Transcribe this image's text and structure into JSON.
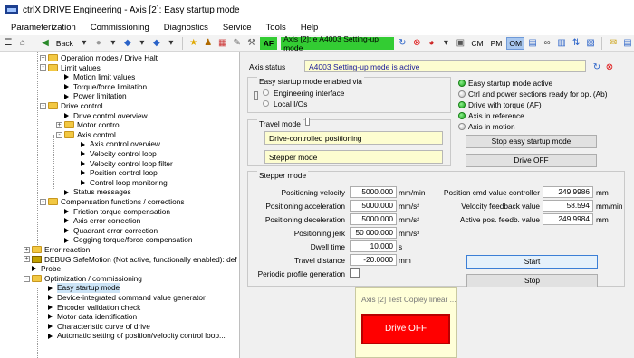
{
  "window": {
    "title": "ctrlX DRIVE Engineering - Axis [2]: Easy startup mode"
  },
  "menu": [
    "Parameterization",
    "Commissioning",
    "Diagnostics",
    "Service",
    "Tools",
    "Help"
  ],
  "toolbar": {
    "back": "Back",
    "af": "AF",
    "axis_status": "Axis [2]: e   A4003 Setting-up mode",
    "cm": "CM",
    "pm": "PM",
    "om": "OM"
  },
  "tree": [
    {
      "label": "Operation modes / Drive Halt",
      "type": "folder",
      "expander": "+",
      "level": 1
    },
    {
      "label": "Limit values",
      "type": "folder",
      "expander": "-",
      "level": 1
    },
    {
      "label": "Motion limit values",
      "type": "item",
      "level": 2
    },
    {
      "label": "Torque/force limitation",
      "type": "item",
      "level": 2
    },
    {
      "label": "Power limitation",
      "type": "item",
      "level": 2
    },
    {
      "label": "Drive control",
      "type": "folder",
      "expander": "-",
      "level": 1
    },
    {
      "label": "Drive control overview",
      "type": "item",
      "level": 2
    },
    {
      "label": "Motor control",
      "type": "folder",
      "expander": "+",
      "level": 2
    },
    {
      "label": "Axis control",
      "type": "folder",
      "expander": "-",
      "level": 2
    },
    {
      "label": "Axis control overview",
      "type": "item",
      "level": 3
    },
    {
      "label": "Velocity control loop",
      "type": "item",
      "level": 3
    },
    {
      "label": "Velocity control loop filter",
      "type": "item",
      "level": 3
    },
    {
      "label": "Position control loop",
      "type": "item",
      "level": 3
    },
    {
      "label": "Control loop monitoring",
      "type": "item",
      "level": 3
    },
    {
      "label": "Status messages",
      "type": "item",
      "level": 2
    },
    {
      "label": "Compensation functions / corrections",
      "type": "folder",
      "expander": "-",
      "level": 1
    },
    {
      "label": "Friction torque compensation",
      "type": "item",
      "level": 2
    },
    {
      "label": "Axis error correction",
      "type": "item",
      "level": 2
    },
    {
      "label": "Quadrant error correction",
      "type": "item",
      "level": 2
    },
    {
      "label": "Cogging torque/force compensation",
      "type": "item",
      "level": 2
    },
    {
      "label": "Error reaction",
      "type": "folder",
      "expander": "+",
      "level": 0
    },
    {
      "label": "DEBUG SafeMotion (Not active, functionally enabled): def",
      "type": "debug",
      "expander": "+",
      "level": 0
    },
    {
      "label": "Probe",
      "type": "item",
      "level": 0
    },
    {
      "label": "Optimization / commissioning",
      "type": "folder",
      "expander": "-",
      "level": 0
    },
    {
      "label": "Easy startup mode",
      "type": "item",
      "level": 1,
      "selected": true
    },
    {
      "label": "Device-integrated command value generator",
      "type": "item",
      "level": 1
    },
    {
      "label": "Encoder validation check",
      "type": "item",
      "level": 1
    },
    {
      "label": "Motor data identification",
      "type": "item",
      "level": 1
    },
    {
      "label": "Characteristic curve of drive",
      "type": "item",
      "level": 1
    },
    {
      "label": "Automatic setting of position/velocity control loop...",
      "type": "item",
      "level": 1
    }
  ],
  "axis_status": {
    "label": "Axis status",
    "value": "A4003 Setting-up mode is active"
  },
  "enable_group": {
    "title": "Easy startup mode enabled via",
    "options": [
      "Engineering interface",
      "Local I/Os"
    ]
  },
  "travel_group": {
    "title": "Travel mode",
    "values": [
      "Drive-controlled positioning",
      "Stepper mode"
    ]
  },
  "status_leds": [
    {
      "label": "Easy startup mode active",
      "on": true
    },
    {
      "label": "Ctrl and power sections ready for op. (Ab)",
      "on": false
    },
    {
      "label": "Drive with torque (AF)",
      "on": true
    },
    {
      "label": "Axis in reference",
      "on": true
    },
    {
      "label": "Axis in motion",
      "on": false
    }
  ],
  "buttons": {
    "stop_easy": "Stop easy startup mode",
    "drive_off": "Drive OFF",
    "start": "Start",
    "stop": "Stop"
  },
  "stepper": {
    "title": "Stepper mode",
    "params": [
      {
        "label": "Positioning velocity",
        "value": "5000.000",
        "unit": "mm/min"
      },
      {
        "label": "Positioning acceleration",
        "value": "5000.000",
        "unit": "mm/s²"
      },
      {
        "label": "Positioning deceleration",
        "value": "5000.000",
        "unit": "mm/s²"
      },
      {
        "label": "Positioning jerk",
        "value": "50 000.000",
        "unit": "mm/s³"
      },
      {
        "label": "Dwell time",
        "value": "10.000",
        "unit": "s"
      },
      {
        "label": "Travel distance",
        "value": "-20.0000",
        "unit": "mm"
      }
    ],
    "periodic_label": "Periodic profile generation",
    "readouts": [
      {
        "label": "Position cmd value controller",
        "value": "249.9986",
        "unit": "mm"
      },
      {
        "label": "Velocity feedback value",
        "value": "58.594",
        "unit": "mm/min"
      },
      {
        "label": "Active pos. feedb. value",
        "value": "249.9984",
        "unit": "mm"
      }
    ]
  },
  "popup": {
    "title": "Axis [2] Test Copley linear ...",
    "button": "Drive OFF"
  }
}
